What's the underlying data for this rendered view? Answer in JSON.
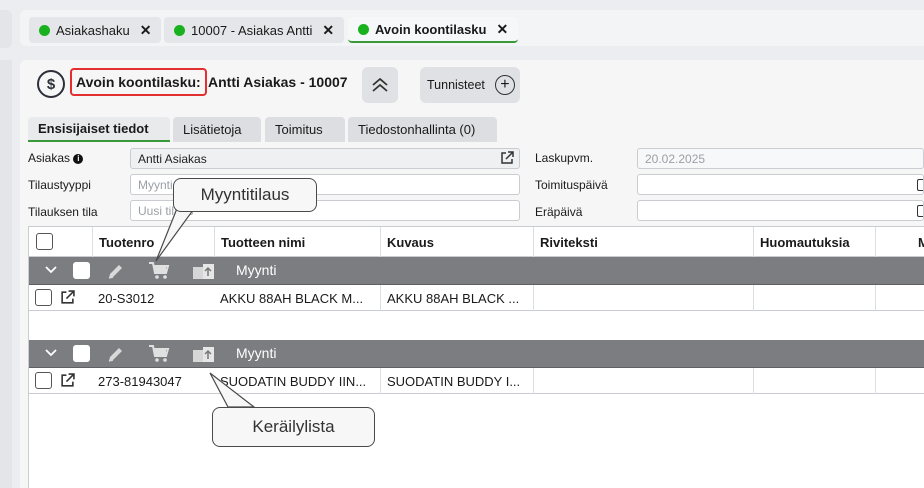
{
  "top_tabs": [
    {
      "label": "Asiakashaku",
      "close": "✕"
    },
    {
      "label": "10007 - Asiakas Antti",
      "close": "✕"
    },
    {
      "label": "Avoin koontilasku",
      "close": "✕"
    }
  ],
  "header": {
    "currency_symbol": "$",
    "title_prefix": "Avoin koontilasku:",
    "title_rest": "Antti Asiakas - 10007",
    "tags_label": "Tunnisteet",
    "tags_plus": "+"
  },
  "sub_tabs": [
    "Ensisijaiset tiedot",
    "Lisätietoja",
    "Toimitus",
    "Tiedostonhallinta (0)"
  ],
  "form": {
    "customer_label": "Asiakas",
    "customer_info": "i",
    "customer_value": "Antti Asiakas",
    "order_type_label": "Tilaustyyppi",
    "order_type_placeholder": "Myynti",
    "order_state_label": "Tilauksen tila",
    "order_state_placeholder": "Uusi tilaus",
    "invoice_date_label": "Laskupvm.",
    "invoice_date_value": "20.02.2025",
    "delivery_date_label": "Toimituspäivä",
    "due_date_label": "Eräpäivä"
  },
  "grid": {
    "columns": [
      "Tuotenro",
      "Tuotteen nimi",
      "Kuvaus",
      "Riviteksti",
      "Huomautuksia",
      "M"
    ],
    "groups": [
      {
        "label": "Myynti",
        "row": {
          "product_no": "20-S3012",
          "name": "AKKU 88AH BLACK M...",
          "desc": "AKKU 88AH BLACK ..."
        }
      },
      {
        "label": "Myynti",
        "row": {
          "product_no": "273-81943047",
          "name": "SUODATIN BUDDY IIN...",
          "desc": "SUODATIN BUDDY I..."
        }
      }
    ]
  },
  "callouts": {
    "sales_order": "Myyntitilaus",
    "picking_list": "Keräilylista"
  }
}
